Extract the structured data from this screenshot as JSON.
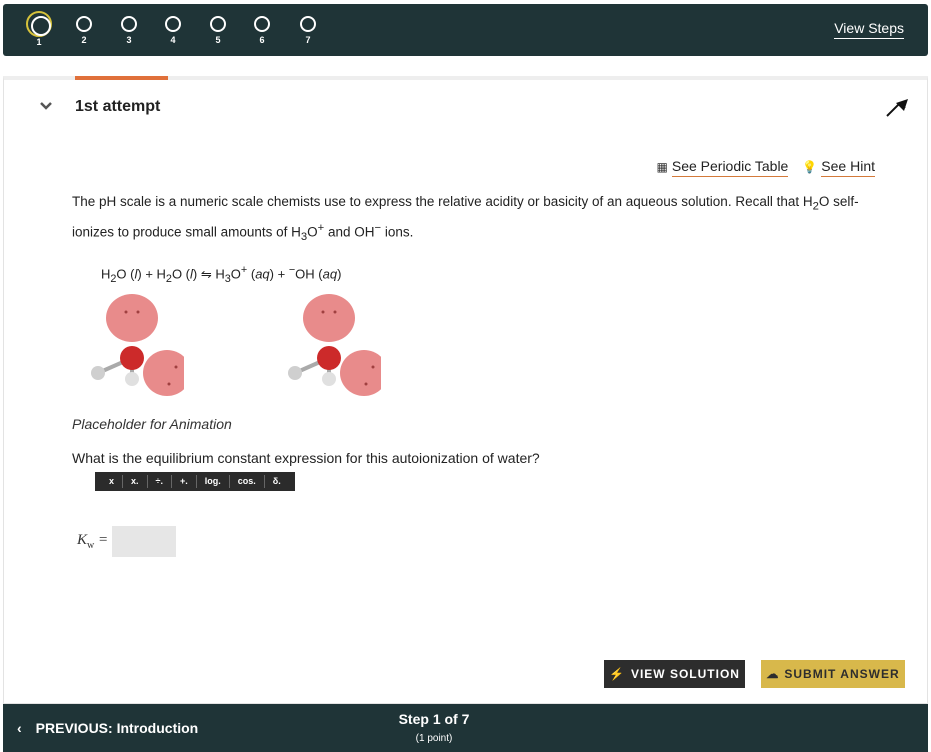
{
  "top_bar": {
    "steps": [
      "1",
      "2",
      "3",
      "4",
      "5",
      "6",
      "7"
    ],
    "active_step": "1",
    "view_steps": "View Steps"
  },
  "attempt": {
    "title": "1st attempt"
  },
  "links": {
    "periodic_table": "See Periodic Table",
    "hint": "See Hint"
  },
  "question": {
    "intro": "The pH scale is a numeric scale chemists use to express the relative acidity or basicity of an aqueous solution.  Recall that H",
    "intro_sub": "2",
    "intro2": "O self-ionizes to produce small amounts of H",
    "intro_sub2": "3",
    "intro3": "O",
    "intro_sup": "+",
    "intro4": " and OH",
    "intro_sup2": "−",
    "intro5": " ions.",
    "equation": {
      "h2o_a": "H",
      "h2o_a_sub": "2",
      "h2o_a_end": "O (",
      "l": "l",
      "close": ") + H",
      "h2o_b_sub": "2",
      "h2o_b_end": "O (",
      "l2": "l",
      "arrow": ") ⇋ H",
      "h3o_sub": "3",
      "h3o_end": "O",
      "h3o_sup": "+",
      "aq": "aq",
      "plus": ") + ",
      "oh_sup": "−",
      "oh": "OH (",
      "aq2": "aq",
      "end": ")"
    },
    "caption": "Placeholder for Animation",
    "prompt": "What is the equilibrium constant expression for this autoionization of water?"
  },
  "math_tools": [
    "x",
    "x.",
    "÷.",
    "+.",
    "log.",
    "cos.",
    "δ."
  ],
  "answer": {
    "label": "K",
    "label_sub": "w",
    "equals": " =",
    "value": ""
  },
  "buttons": {
    "view_solution": "VIEW SOLUTION",
    "submit_answer": "SUBMIT ANSWER"
  },
  "bottom_bar": {
    "previous": "PREVIOUS: Introduction",
    "step": "Step 1 of 7",
    "points": "(1 point)"
  }
}
